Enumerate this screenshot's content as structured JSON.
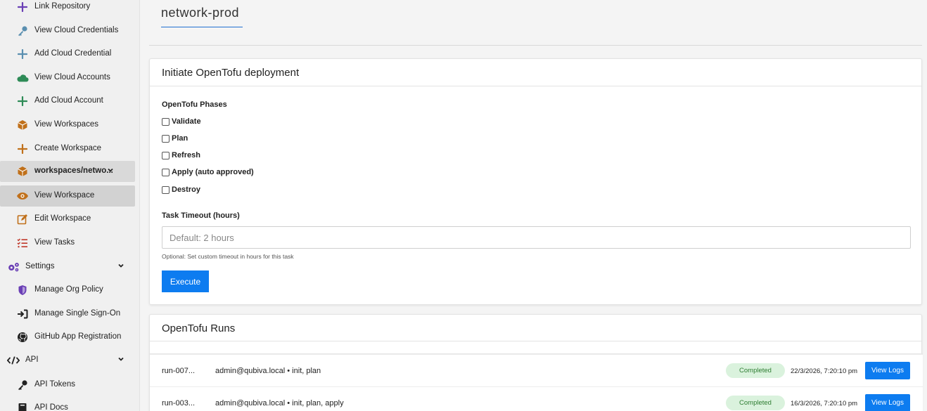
{
  "sidebar": {
    "items": [
      {
        "label": "Link Repository",
        "icon": "plus-icon"
      },
      {
        "label": "View Cloud Credentials",
        "icon": "key-icon"
      },
      {
        "label": "Add Cloud Credential",
        "icon": "plus-icon"
      },
      {
        "label": "View Cloud Accounts",
        "icon": "cloud-icon"
      },
      {
        "label": "Add Cloud Account",
        "icon": "plus-icon"
      },
      {
        "label": "View Workspaces",
        "icon": "cube-icon"
      },
      {
        "label": "Create Workspace",
        "icon": "plus-icon"
      },
      {
        "label": "workspaces/netwo...",
        "icon": "cube-icon"
      },
      {
        "label": "View Workspace",
        "icon": "eye-icon"
      },
      {
        "label": "Edit Workspace",
        "icon": "edit-icon"
      },
      {
        "label": "View Tasks",
        "icon": "tasks-icon"
      },
      {
        "label": "Settings",
        "icon": "gears-icon"
      },
      {
        "label": "Manage Org Policy",
        "icon": "shield-icon"
      },
      {
        "label": "Manage Single Sign-On",
        "icon": "sign-in-icon"
      },
      {
        "label": "GitHub App Registration",
        "icon": "github-icon"
      },
      {
        "label": "API",
        "icon": "code-icon"
      },
      {
        "label": "API Tokens",
        "icon": "key-icon"
      },
      {
        "label": "API Docs",
        "icon": "book-icon"
      }
    ]
  },
  "workspace": {
    "title": "network-prod"
  },
  "deploy": {
    "header": "Initiate OpenTofu deployment",
    "phases_label": "OpenTofu Phases",
    "phases": [
      "Validate",
      "Plan",
      "Refresh",
      "Apply (auto approved)",
      "Destroy"
    ],
    "timeout_label": "Task Timeout (hours)",
    "timeout_placeholder": "Default: 2 hours",
    "timeout_help": "Optional: Set custom timeout in hours for this task",
    "execute_label": "Execute"
  },
  "runs": {
    "header": "OpenTofu Runs",
    "rows": [
      {
        "id": "run-007...",
        "meta": "admin@qubiva.local • init, plan",
        "status": "Completed",
        "time": "22/3/2026, 7:20:10 pm",
        "action": "View Logs"
      },
      {
        "id": "run-003...",
        "meta": "admin@qubiva.local • init, plan, apply",
        "status": "Completed",
        "time": "16/3/2026, 7:20:10 pm",
        "action": "View Logs"
      }
    ]
  },
  "colors": {
    "accent": "#0d7cf0",
    "badge_bg": "#daf2dd",
    "badge_text": "#2e7d32"
  }
}
